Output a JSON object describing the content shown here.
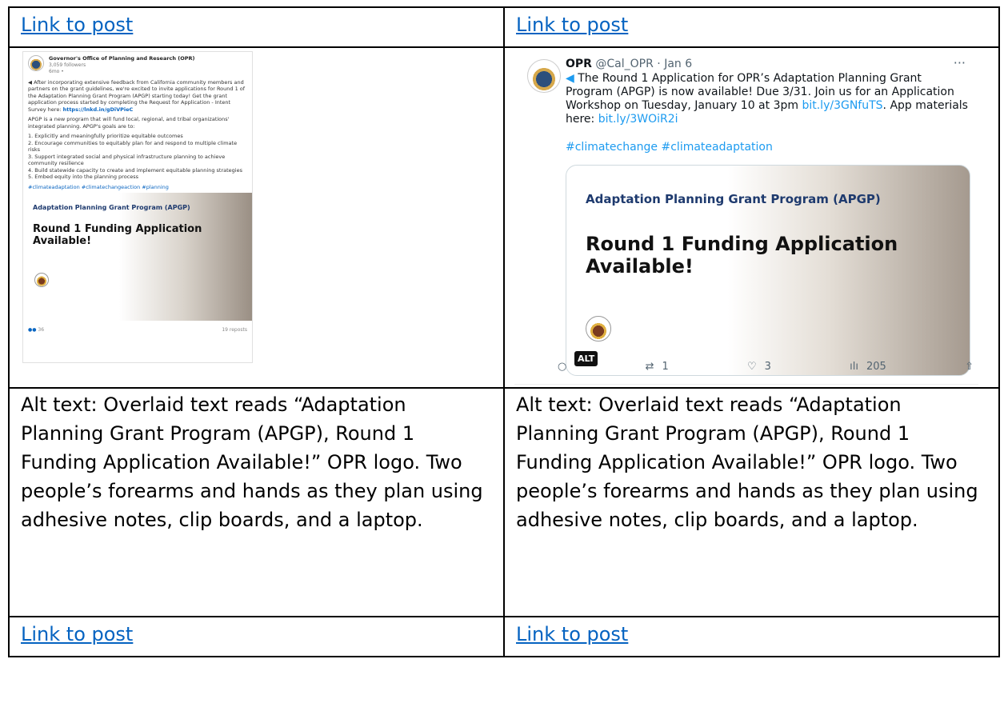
{
  "cells": {
    "top_left_link": "Link to post",
    "top_right_link": "Link to post",
    "bottom_left_link": "Link to post",
    "bottom_right_link": "Link to post",
    "alt_left": "Alt text: Overlaid text reads “Adaptation Planning Grant Program (APGP), Round 1 Funding Application Available!” OPR logo. Two people’s forearms and hands as they plan using adhesive notes, clip boards, and a laptop.",
    "alt_right": "Alt text: Overlaid text reads “Adaptation Planning Grant Program (APGP), Round 1 Funding Application Available!” OPR logo. Two people’s forearms and hands as they plan using adhesive notes, clip boards, and a laptop."
  },
  "linkedin": {
    "org": "Governor's Office of Planning and Research (OPR)",
    "followers": "3,059 followers",
    "age": "6mo •",
    "para1": "After incorporating extensive feedback from California community members and partners on the grant guidelines, we're excited to invite applications for Round 1 of the Adaptation Planning Grant Program (APGP) starting today! Get the grant application process started by completing the Request for Application - Intent Survey here:",
    "para1_link": "https://lnkd.in/gDiVPieC",
    "para2": "APGP is a new program that will fund local, regional, and tribal organizations' integrated planning. APGP's goals are to:",
    "goals": [
      "1. Explicitly and meaningfully prioritize equitable outcomes",
      "2. Encourage communities to equitably plan for and respond to multiple climate risks",
      "3. Support integrated social and physical infrastructure planning to achieve community resilience",
      "4. Build statewide capacity to create and implement equitable planning strategies",
      "5. Embed equity into the planning process"
    ],
    "tags": "#climateadaptation #climatechangeaction #planning",
    "image_title": "Adaptation Planning Grant Program (APGP)",
    "image_headline": "Round 1 Funding Application Available!",
    "reactions": "36",
    "reposts": "19 reposts"
  },
  "tweet": {
    "name": "OPR",
    "handle": "@Cal_OPR · Jan 6",
    "more": "···",
    "text_a": "The Round 1 Application for OPR’s Adaptation Planning Grant Program (APGP) is now available! Due 3/31. Join us for an Application Workshop on Tuesday, January 10 at 3pm",
    "link1": "bit.ly/3GNfuTS",
    "text_b": ". App materials here:",
    "link2": "bit.ly/3WOiR2i",
    "tags": "#climatechange #climateadaptation",
    "image_title": "Adaptation Planning Grant Program (APGP)",
    "image_headline": "Round 1 Funding Application Available!",
    "alt_badge": "ALT",
    "retweets": "1",
    "likes": "3",
    "views": "205"
  }
}
